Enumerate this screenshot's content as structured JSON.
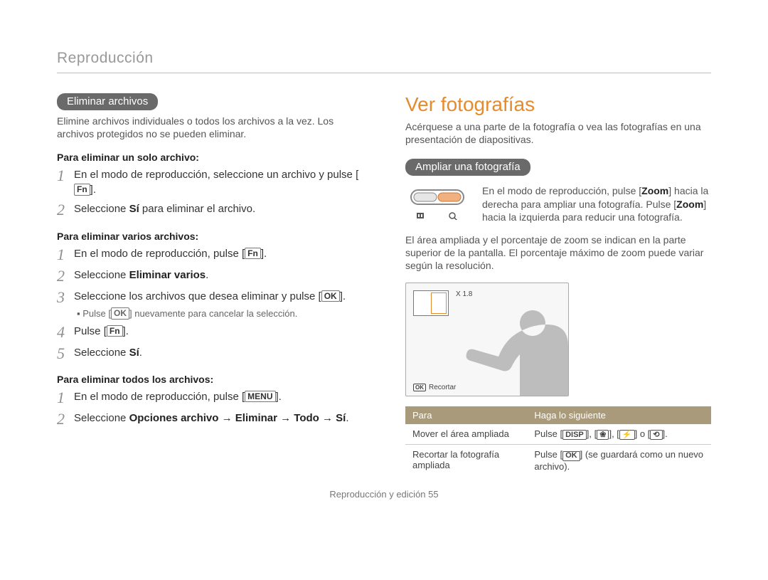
{
  "breadcrumb": "Reproducción",
  "left": {
    "pill": "Eliminar archivos",
    "intro": "Elimine archivos individuales o todos los archivos a la vez. Los archivos protegidos no se pueden eliminar.",
    "s1_label": "Para eliminar un solo archivo:",
    "s1_step1_a": "En el modo de reproducción, seleccione un archivo y pulse [",
    "s1_step1_btn": "Fn",
    "s1_step1_b": "].",
    "s1_step2_a": "Seleccione ",
    "s1_step2_bold": "Sí",
    "s1_step2_b": " para eliminar el archivo.",
    "s2_label": "Para eliminar varios archivos:",
    "s2_step1_a": "En el modo de reproducción, pulse [",
    "s2_step1_btn": "Fn",
    "s2_step1_b": "].",
    "s2_step2_a": "Seleccione ",
    "s2_step2_bold": "Eliminar varios",
    "s2_step2_b": ".",
    "s2_step3_a": "Seleccione los archivos que desea eliminar y pulse [",
    "s2_step3_btn": "OK",
    "s2_step3_b": "].",
    "s2_step3_sub_a": "Pulse [",
    "s2_step3_sub_btn": "OK",
    "s2_step3_sub_b": "] nuevamente para cancelar la selección.",
    "s2_step4_a": "Pulse [",
    "s2_step4_btn": "Fn",
    "s2_step4_b": "].",
    "s2_step5_a": "Seleccione ",
    "s2_step5_bold": "Sí",
    "s2_step5_b": ".",
    "s3_label": "Para eliminar todos los archivos:",
    "s3_step1_a": "En el modo de reproducción, pulse [",
    "s3_step1_btn": "MENU",
    "s3_step1_b": "].",
    "s3_step2_a": "Seleccione ",
    "s3_step2_bold": "Opciones archivo → Eliminar → Todo → Sí",
    "s3_step2_b": "."
  },
  "right": {
    "h2": "Ver fotografías",
    "intro": "Acérquese a una parte de la fotografía o vea las fotografías en una presentación de diapositivas.",
    "pill": "Ampliar una fotografía",
    "zoom_a": "En el modo de reproducción, pulse [",
    "zoom_b1": "Zoom",
    "zoom_c": "] hacia la derecha para ampliar una fotografía. Pulse [",
    "zoom_b2": "Zoom",
    "zoom_d": "] hacia la izquierda para reducir una fotografía.",
    "area_text": "El área ampliada y el porcentaje de zoom se indican en la parte superior de la pantalla. El porcentaje máximo de zoom puede variar según la resolución.",
    "preview_zoom": "X 1.8",
    "preview_ok": "OK",
    "preview_cut": "Recortar",
    "table": {
      "th1": "Para",
      "th2": "Haga lo siguiente",
      "r1c1": "Mover el área ampliada",
      "r1c2_a": "Pulse [",
      "r1c2_k1": "DISP",
      "r1c2_sep1": "], [",
      "r1c2_k2": "❀",
      "r1c2_sep2": "], [",
      "r1c2_k3": "⚡",
      "r1c2_sep3": "] o [",
      "r1c2_k4": "⟲",
      "r1c2_b": "].",
      "r2c1": "Recortar la fotografía ampliada",
      "r2c2_a": "Pulse [",
      "r2c2_btn": "OK",
      "r2c2_b": "] (se guardará como un nuevo archivo)."
    }
  },
  "footer_a": "Reproducción y edición  ",
  "footer_page": "55"
}
